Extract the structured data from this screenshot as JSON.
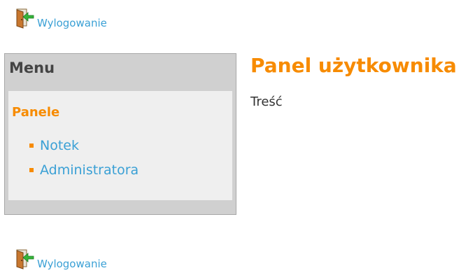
{
  "header": {
    "logout_label": "Wylogowanie",
    "logout_icon": "logout-door-icon"
  },
  "sidebar": {
    "title": "Menu",
    "section_title": "Panele",
    "items": [
      {
        "label": "Notek"
      },
      {
        "label": "Administratora"
      }
    ]
  },
  "main": {
    "title": "Panel użytkownika",
    "content": "Treść"
  },
  "footer": {
    "logout_label": "Wylogowanie",
    "logout_icon": "logout-door-icon"
  },
  "colors": {
    "accent": "#f78b00",
    "link": "#3aa0d5",
    "sidebar_bg": "#d0d0d0",
    "sidebar_inner_bg": "#efefef",
    "text": "#333333"
  }
}
